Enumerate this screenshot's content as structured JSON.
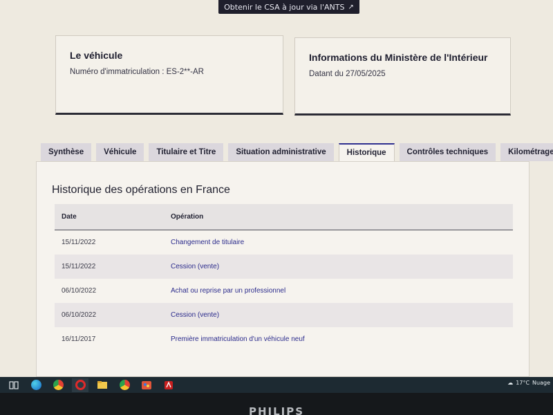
{
  "top_button": {
    "label": "Obtenir le CSA à jour via l'ANTS",
    "icon": "external-link-icon"
  },
  "vehicule_card": {
    "title": "Le véhicule",
    "immatriculation": "Numéro d'immatriculation : ES-2**-AR"
  },
  "ministere_card": {
    "title": "Informations du Ministère de l'Intérieur",
    "date": "Datant du 27/05/2025"
  },
  "tabs": [
    {
      "label": "Synthèse"
    },
    {
      "label": "Véhicule"
    },
    {
      "label": "Titulaire et Titre"
    },
    {
      "label": "Situation administrative"
    },
    {
      "label": "Historique",
      "active": true
    },
    {
      "label": "Contrôles techniques"
    },
    {
      "label": "Kilométrage"
    }
  ],
  "history": {
    "title": "Historique des opérations en France",
    "columns": {
      "date": "Date",
      "operation": "Opération"
    },
    "rows": [
      {
        "date": "15/11/2022",
        "operation": "Changement de titulaire"
      },
      {
        "date": "15/11/2022",
        "operation": "Cession (vente)"
      },
      {
        "date": "06/10/2022",
        "operation": "Achat ou reprise par un professionnel"
      },
      {
        "date": "06/10/2022",
        "operation": "Cession (vente)"
      },
      {
        "date": "16/11/2017",
        "operation": "Première immatriculation d'un véhicule neuf"
      }
    ]
  },
  "taskbar": {
    "icons": [
      "task-view-icon",
      "edge-icon",
      "chrome-icon",
      "opera-icon",
      "file-explorer-icon",
      "chrome-profile-icon",
      "paint-icon",
      "acrobat-icon"
    ],
    "weather": {
      "temperature": "17°C",
      "condition": "Nuage"
    }
  },
  "monitor": {
    "brand": "PHILIPS"
  },
  "colors": {
    "link": "#2b2b8c",
    "active_tab_border": "#2f2f8f",
    "taskbar": "#1d2a32"
  }
}
